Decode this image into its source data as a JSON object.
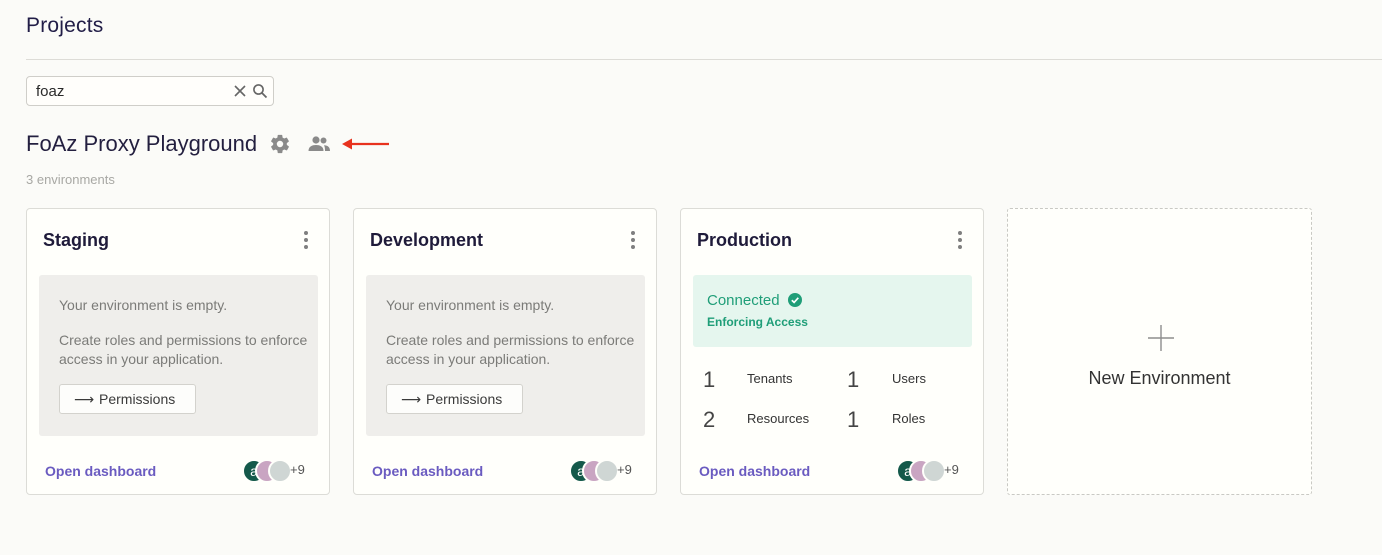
{
  "page": {
    "title": "Projects"
  },
  "search": {
    "value": "foaz"
  },
  "project": {
    "name": "FoAz Proxy Playground",
    "env_count_text": "3 environments"
  },
  "environments": [
    {
      "title": "Staging",
      "empty_line1": "Your environment is empty.",
      "empty_line2": "Create roles and permissions to enforce access in your application.",
      "permissions_button": "Permissions",
      "open_dashboard": "Open dashboard",
      "avatar_initial": "a",
      "more_members": "+9"
    },
    {
      "title": "Development",
      "empty_line1": "Your environment is empty.",
      "empty_line2": "Create roles and permissions to enforce access in your application.",
      "permissions_button": "Permissions",
      "open_dashboard": "Open dashboard",
      "avatar_initial": "a",
      "more_members": "+9"
    },
    {
      "title": "Production",
      "status": "Connected",
      "status_sub": "Enforcing Access",
      "stats": [
        {
          "value": "1",
          "label": "Tenants"
        },
        {
          "value": "1",
          "label": "Users"
        },
        {
          "value": "2",
          "label": "Resources"
        },
        {
          "value": "1",
          "label": "Roles"
        }
      ],
      "open_dashboard": "Open dashboard",
      "avatar_initial": "a",
      "more_members": "+9"
    }
  ],
  "new_environment": {
    "label": "New Environment"
  },
  "colors": {
    "accent_link": "#6a5bc0",
    "connected_green": "#1f9e78",
    "annotation_arrow": "#e8321e"
  }
}
